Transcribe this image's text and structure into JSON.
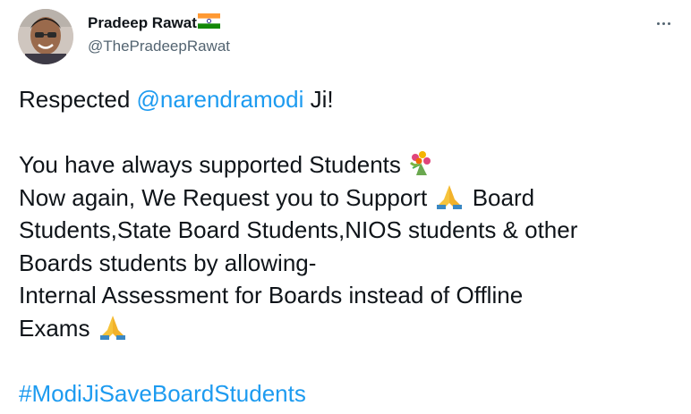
{
  "tweet": {
    "author": {
      "display_name": "Pradeep Rawat",
      "flag_icon": "india-flag-icon",
      "handle": "@ThePradeepRawat"
    },
    "more_icon": "more-options-icon",
    "body": {
      "line1_prefix": "Respected ",
      "mention": "@narendramodi",
      "line1_suffix": " Ji!",
      "line2": "You have always supported Students ",
      "line3_a": "Now again, We Request you to Support ",
      "line3_b": " Board",
      "line4": "Students,State Board Students,NIOS students & other",
      "line5": "Boards students by allowing-",
      "line6": "Internal Assessment for Boards instead of Offline",
      "line7": "Exams ",
      "hashtag": "#ModiJiSaveBoardStudents"
    },
    "colors": {
      "link": "#1d9bf0",
      "text": "#0f1419",
      "secondary": "#536471"
    }
  }
}
